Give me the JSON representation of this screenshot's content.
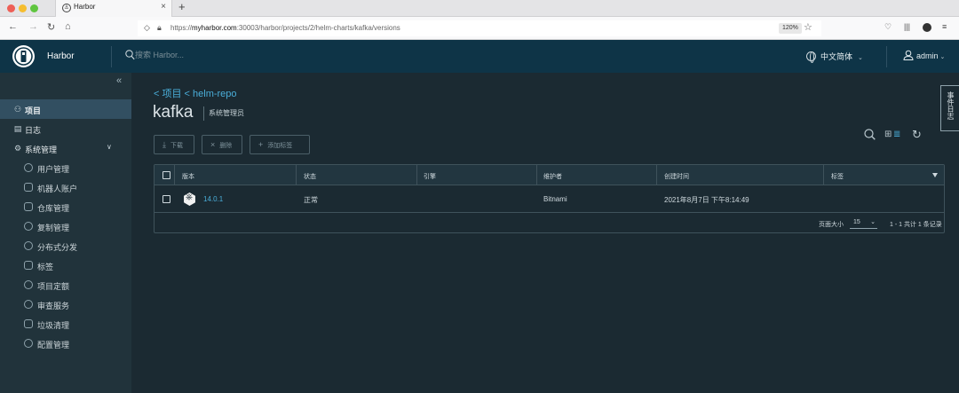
{
  "browser": {
    "tab_title": "Harbor",
    "tab_close": "×",
    "new_tab": "+",
    "url_prefix": "https://",
    "url_host": "myharbor.com",
    "url_path": ":30003/harbor/projects/2/helm-charts/kafka/versions",
    "zoom": "120%"
  },
  "header": {
    "brand": "Harbor",
    "search_placeholder": "搜索 Harbor...",
    "language": "中文简体",
    "user": "admin"
  },
  "sidebar": {
    "items": [
      {
        "label": "项目",
        "icon": "projects-icon",
        "active": true
      },
      {
        "label": "日志",
        "icon": "logs-icon"
      },
      {
        "label": "系统管理",
        "icon": "admin-icon"
      }
    ],
    "sub_items": [
      {
        "label": "用户管理",
        "icon": "users-icon"
      },
      {
        "label": "机器人账户",
        "icon": "robot-icon"
      },
      {
        "label": "仓库管理",
        "icon": "registry-icon"
      },
      {
        "label": "复制管理",
        "icon": "replication-icon"
      },
      {
        "label": "分布式分发",
        "icon": "distribution-icon"
      },
      {
        "label": "标签",
        "icon": "tag-icon"
      },
      {
        "label": "项目定额",
        "icon": "quota-icon"
      },
      {
        "label": "审查服务",
        "icon": "scanner-icon"
      },
      {
        "label": "垃圾清理",
        "icon": "gc-icon"
      },
      {
        "label": "配置管理",
        "icon": "config-icon"
      }
    ]
  },
  "page": {
    "breadcrumb": "< 项目 < helm-repo",
    "title": "kafka",
    "role": "系统管理员",
    "event_tab": "事件日志"
  },
  "toolbar": {
    "download": "下载",
    "delete": "删除",
    "add_label": "添加标签"
  },
  "table": {
    "columns": [
      "版本",
      "状态",
      "引擎",
      "维护者",
      "创建时间",
      "标签"
    ],
    "rows": [
      {
        "version": "14.0.1",
        "status": "正常",
        "engine": "",
        "maintainer": "Bitnami",
        "created": "2021年8月7日 下午8:14:49",
        "labels": ""
      }
    ],
    "page_size_label": "页面大小",
    "page_size": "15",
    "total": "1 - 1 共计 1 条记录"
  }
}
